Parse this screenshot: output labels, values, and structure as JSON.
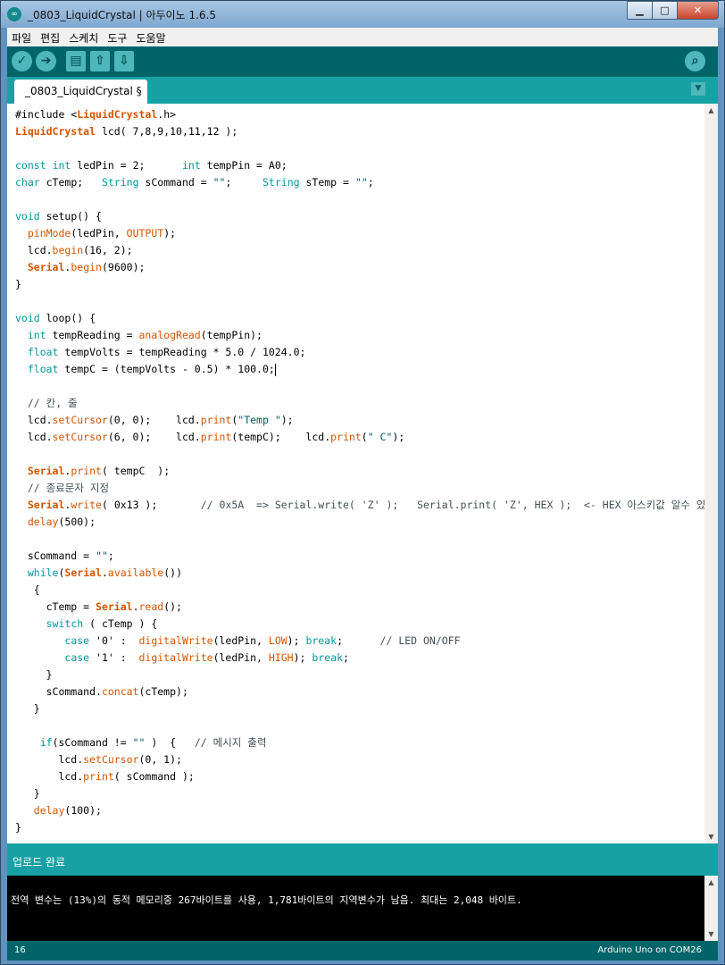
{
  "window": {
    "title": "_0803_LiquidCrystal | 아두이노 1.6.5",
    "app_icon": "arduino-icon",
    "minimize": "▁",
    "maximize": "□",
    "close": "✕"
  },
  "menu": [
    "파일",
    "편집",
    "스케치",
    "도구",
    "도움말"
  ],
  "toolbar": {
    "verify_icon": "✓",
    "upload_icon": "➔",
    "new_icon": "▤",
    "open_icon": "⇧",
    "save_icon": "⇩",
    "serial_monitor_icon": "⌕"
  },
  "tab": {
    "name": "_0803_LiquidCrystal §",
    "menu_icon": "▼"
  },
  "editor": {
    "lines": [
      "#include <LiquidCrystal.h>",
      "LiquidCrystal lcd( 7,8,9,10,11,12 );",
      "",
      "const int ledPin = 2;      int tempPin = A0;",
      "char cTemp;   String sCommand = \"\";     String sTemp = \"\";",
      "",
      "void setup() {",
      "  pinMode(ledPin, OUTPUT);",
      "  lcd.begin(16, 2);",
      "  Serial.begin(9600);",
      "}",
      "",
      "void loop() {",
      "  int tempReading = analogRead(tempPin);",
      "  float tempVolts = tempReading * 5.0 / 1024.0;",
      "  float tempC = (tempVolts - 0.5) * 100.0;",
      "",
      "  // 칸, 줄",
      "  lcd.setCursor(0, 0);    lcd.print(\"Temp \");",
      "  lcd.setCursor(6, 0);    lcd.print(tempC);    lcd.print(\" C\");",
      "",
      "  Serial.print( tempC  );",
      "  // 종료문자 지정",
      "  Serial.write( 0x13 );       // 0x5A  => Serial.write( 'Z' );   Serial.print( 'Z', HEX );  <- HEX 아스키값 알수 있음.",
      "  delay(500);",
      "",
      "  sCommand = \"\";",
      "  while(Serial.available())",
      "   {",
      "     cTemp = Serial.read();",
      "     switch ( cTemp ) {",
      "        case '0' :  digitalWrite(ledPin, LOW); break;      // LED ON/OFF",
      "        case '1' :  digitalWrite(ledPin, HIGH); break;",
      "     }",
      "     sCommand.concat(cTemp);",
      "   }",
      "",
      "    if(sCommand != \"\" )  {   // 메시지 출력",
      "       lcd.setCursor(0, 1);",
      "       lcd.print( sCommand );",
      "   }",
      "   delay(100);",
      "}"
    ]
  },
  "status": {
    "message": "업로드 완료"
  },
  "console": {
    "output": "전역 변수는 (13%)의 동적 메모리중 267바이트를 사용, 1,781바이트의 지역변수가 남음. 최대는 2,048 바이트."
  },
  "footer": {
    "line_number": "16",
    "board": "Arduino Uno on COM26"
  },
  "colors": {
    "teal_dark": "#006468",
    "teal": "#17a1a5",
    "keyword": "#00979c",
    "function": "#d35400"
  }
}
